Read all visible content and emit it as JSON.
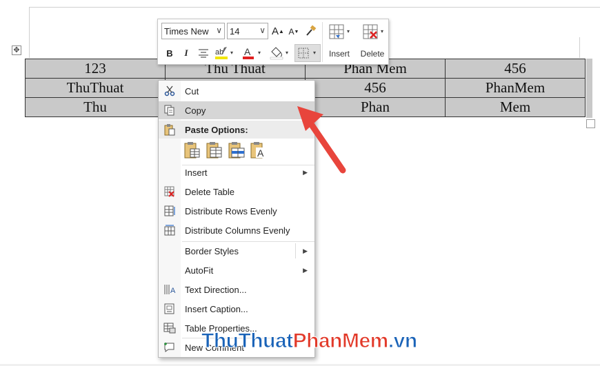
{
  "toolbar": {
    "font_name": "Times New",
    "font_size": "14",
    "bold": "B",
    "italic": "I",
    "insert_label": "Insert",
    "delete_label": "Delete"
  },
  "table": {
    "rows": [
      [
        "123",
        "Thu Thuat",
        "Phan Mem",
        "456"
      ],
      [
        "ThuThuat",
        "",
        "456",
        "PhanMem"
      ],
      [
        "Thu",
        "",
        "Phan",
        "Mem"
      ]
    ]
  },
  "menu": {
    "cut": "Cut",
    "copy": "Copy",
    "paste_options": "Paste Options:",
    "insert": "Insert",
    "delete_table": "Delete Table",
    "distribute_rows": "Distribute Rows Evenly",
    "distribute_columns": "Distribute Columns Evenly",
    "border_styles": "Border Styles",
    "autofit": "AutoFit",
    "text_direction": "Text Direction...",
    "insert_caption": "Insert Caption...",
    "table_properties": "Table Properties...",
    "new_comment": "New Comment"
  },
  "watermark": {
    "part1": "ThuThuat",
    "part2": "PhanMem",
    "part3": ".vn"
  },
  "colors": {
    "arrow": "#e8453c",
    "highlight": "#d6d6d6",
    "table_fill": "#c9c9c9",
    "font_color_bar": "#e02020",
    "highlight_bar": "#f2e600"
  }
}
